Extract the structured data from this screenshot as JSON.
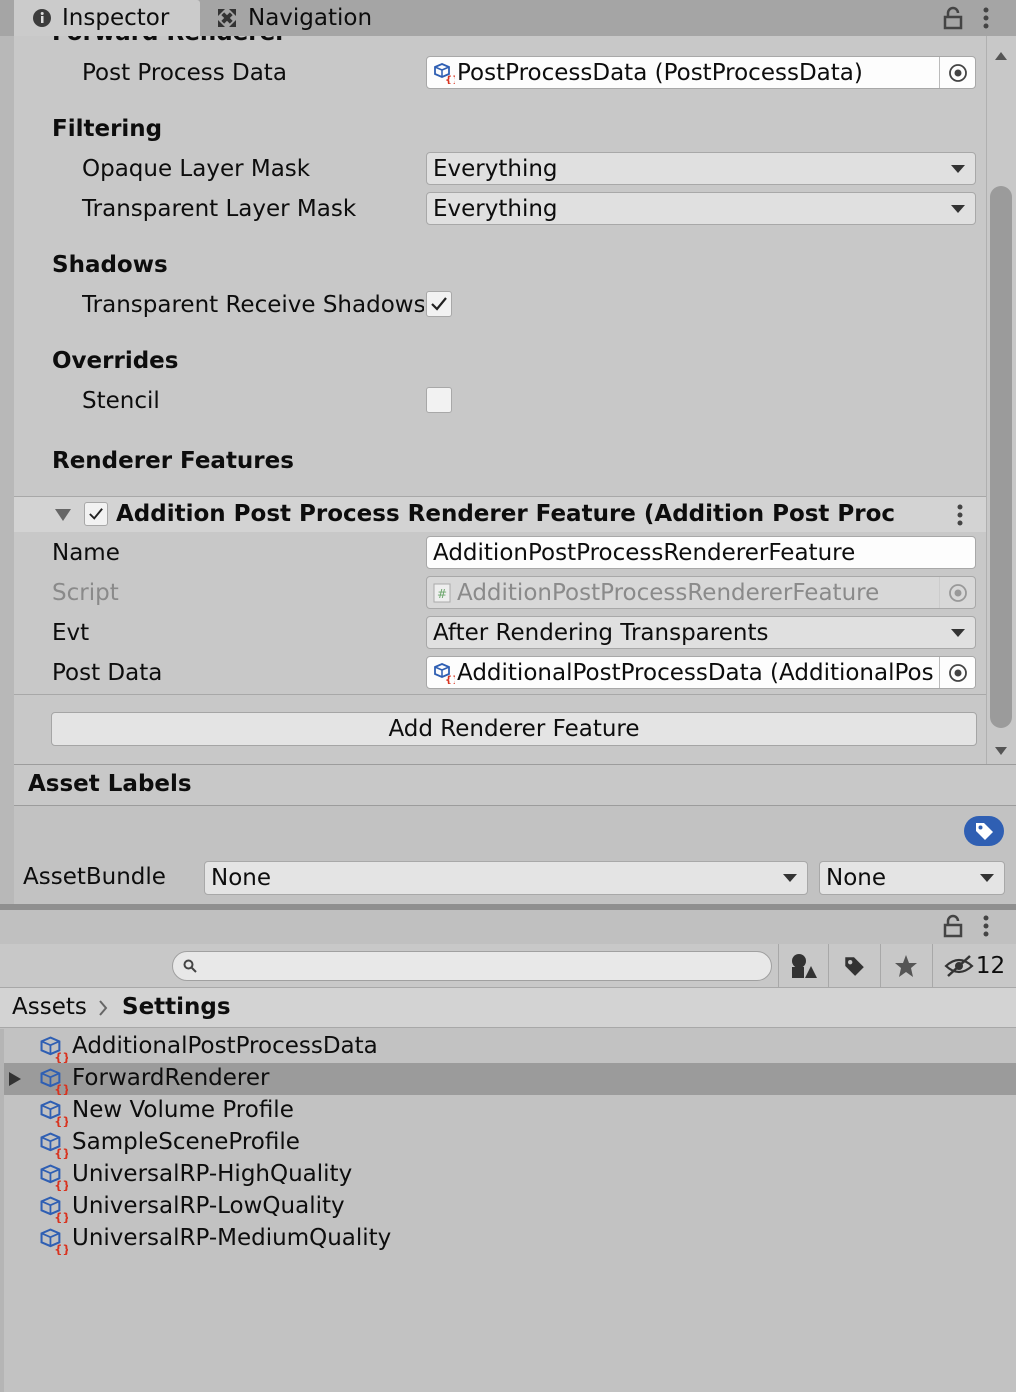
{
  "tabs": {
    "inspector": "Inspector",
    "navigation": "Navigation"
  },
  "inspector": {
    "clipped_header": "Forward Renderer",
    "post_process_data": {
      "label": "Post Process Data",
      "value": "PostProcessData (PostProcessData)"
    },
    "filtering": {
      "header": "Filtering",
      "opaque": {
        "label": "Opaque Layer Mask",
        "value": "Everything"
      },
      "transparent": {
        "label": "Transparent Layer Mask",
        "value": "Everything"
      }
    },
    "shadows": {
      "header": "Shadows",
      "transparent_receive": {
        "label": "Transparent Receive Shadows",
        "checked": true
      }
    },
    "overrides": {
      "header": "Overrides",
      "stencil": {
        "label": "Stencil",
        "checked": false
      }
    },
    "renderer_features": {
      "header": "Renderer Features",
      "feature_title": "Addition Post Process Renderer Feature (Addition Post Process Re",
      "name": {
        "label": "Name",
        "value": "AdditionPostProcessRendererFeature"
      },
      "script": {
        "label": "Script",
        "value": "AdditionPostProcessRendererFeature"
      },
      "evt": {
        "label": "Evt",
        "value": "After Rendering Transparents"
      },
      "post_data": {
        "label": "Post Data",
        "value": "AdditionalPostProcessData (AdditionalPost"
      },
      "add_button": "Add Renderer Feature"
    }
  },
  "asset_labels": {
    "header": "Asset Labels",
    "assetbundle_label": "AssetBundle",
    "bundle_name": "None",
    "bundle_variant": "None"
  },
  "project": {
    "search": {
      "placeholder": "",
      "value": ""
    },
    "hidden_count": "12",
    "breadcrumb": {
      "root": "Assets",
      "current": "Settings"
    },
    "files": [
      {
        "name": "AdditionalPostProcessData",
        "selected": false,
        "expandable": false
      },
      {
        "name": "ForwardRenderer",
        "selected": true,
        "expandable": true
      },
      {
        "name": "New Volume Profile",
        "selected": false,
        "expandable": false
      },
      {
        "name": "SampleSceneProfile",
        "selected": false,
        "expandable": false
      },
      {
        "name": "UniversalRP-HighQuality",
        "selected": false,
        "expandable": false
      },
      {
        "name": "UniversalRP-LowQuality",
        "selected": false,
        "expandable": false
      },
      {
        "name": "UniversalRP-MediumQuality",
        "selected": false,
        "expandable": false
      }
    ]
  },
  "colors": {
    "accent_blue": "#2f5fb3",
    "asset_icon_red": "#d8331f",
    "selected_row": "#9b9b9b"
  }
}
